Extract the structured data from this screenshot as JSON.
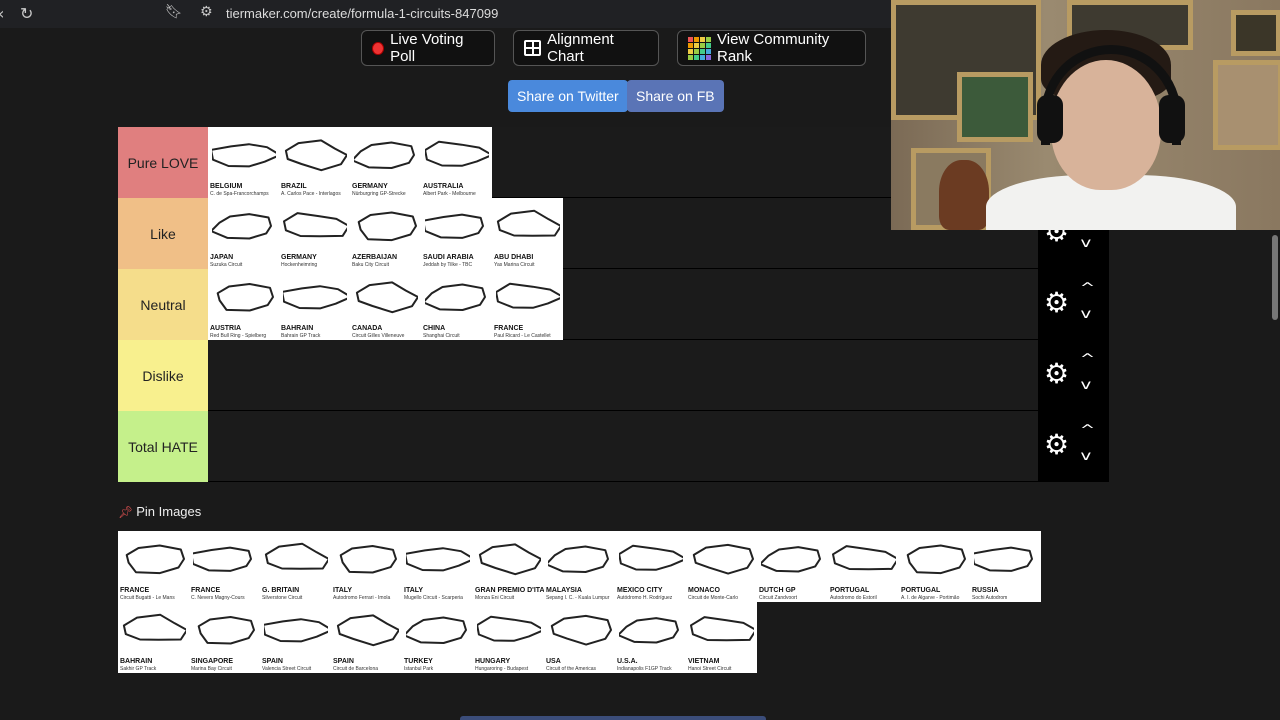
{
  "browser": {
    "url": "tiermaker.com/create/formula-1-circuits-847099",
    "reload_icon": "reload-icon",
    "bookmark_icon": "bookmark-icon",
    "site_settings_icon": "site-settings-icon"
  },
  "actions": {
    "live_voting": "Live Voting Poll",
    "alignment_chart": "Alignment Chart",
    "community_rank": "View Community Rank",
    "share_twitter": "Share on Twitter",
    "share_fb": "Share on FB"
  },
  "tiers": [
    {
      "label": "Pure LOVE",
      "color": "#e07f7f",
      "items": [
        {
          "name": "BELGIUM",
          "sub": "C. de Spa-Francorchamps"
        },
        {
          "name": "BRAZIL",
          "sub": "A. Carlos Pace - Interlagos"
        },
        {
          "name": "GERMANY",
          "sub": "Nürburgring GP-Strecke"
        },
        {
          "name": "AUSTRALIA",
          "sub": "Albert Park - Melbourne"
        }
      ]
    },
    {
      "label": "Like",
      "color": "#f0bf87",
      "items": [
        {
          "name": "JAPAN",
          "sub": "Suzuka Circuit"
        },
        {
          "name": "GERMANY",
          "sub": "Hockenheimring"
        },
        {
          "name": "AZERBAIJAN",
          "sub": "Baku City Circuit"
        },
        {
          "name": "SAUDI ARABIA",
          "sub": "Jeddah by Tilke - TBC"
        },
        {
          "name": "ABU DHABI",
          "sub": "Yas Marina Circuit"
        }
      ]
    },
    {
      "label": "Neutral",
      "color": "#f5dd8b",
      "items": [
        {
          "name": "AUSTRIA",
          "sub": "Red Bull Ring - Spielberg"
        },
        {
          "name": "BAHRAIN",
          "sub": "Bahrain GP Track"
        },
        {
          "name": "CANADA",
          "sub": "Circuit Gilles Villeneuve"
        },
        {
          "name": "CHINA",
          "sub": "Shanghai Circuit"
        },
        {
          "name": "FRANCE",
          "sub": "Paul Ricard - Le Castellet"
        }
      ]
    },
    {
      "label": "Dislike",
      "color": "#f8f08e",
      "items": []
    },
    {
      "label": "Total HATE",
      "color": "#c5f08b",
      "items": []
    }
  ],
  "tier_controls": {
    "gear_icon": "gear-icon",
    "up_icon": "chevron-up-icon",
    "down_icon": "chevron-down-icon"
  },
  "pin": {
    "label": "Pin Images",
    "icon": "pushpin-icon"
  },
  "pool": [
    {
      "name": "FRANCE",
      "sub": "Circuit Bugatti - Le Mans"
    },
    {
      "name": "FRANCE",
      "sub": "C. Nevers Magny-Cours"
    },
    {
      "name": "G. BRITAIN",
      "sub": "Silverstone Circuit"
    },
    {
      "name": "ITALY",
      "sub": "Autodromo Ferrari - Imola"
    },
    {
      "name": "ITALY",
      "sub": "Mugello Circuit - Scarperia"
    },
    {
      "name": "GRAN PREMIO D'ITALIA",
      "sub": "Monza Eni Circuit"
    },
    {
      "name": "MALAYSIA",
      "sub": "Sepang I. C. - Kuala Lumpur"
    },
    {
      "name": "MEXICO CITY",
      "sub": "Autódromo H. Rodríguez"
    },
    {
      "name": "MONACO",
      "sub": "Circuit de Monte-Carlo"
    },
    {
      "name": "DUTCH GP",
      "sub": "Circuit Zandvoort"
    },
    {
      "name": "PORTUGAL",
      "sub": "Autodromo do Estoril"
    },
    {
      "name": "PORTUGAL",
      "sub": "A. I. de Algarve - Portimão"
    },
    {
      "name": "RUSSIA",
      "sub": "Sochi Autodrom"
    },
    {
      "name": "BAHRAIN",
      "sub": "Sakhir GP Track"
    },
    {
      "name": "SINGAPORE",
      "sub": "Marina Bay Circuit"
    },
    {
      "name": "SPAIN",
      "sub": "Valencia Street Circuit"
    },
    {
      "name": "SPAIN",
      "sub": "Circuit de Barcelona"
    },
    {
      "name": "TURKEY",
      "sub": "Istanbul Park"
    },
    {
      "name": "HUNGARY",
      "sub": "Hungaroring - Budapest"
    },
    {
      "name": "USA",
      "sub": "Circuit of the Americas"
    },
    {
      "name": "U.S.A.",
      "sub": "Indianapolis F1GP Track"
    },
    {
      "name": "VIETNAM",
      "sub": "Hanoi Street Circuit"
    }
  ]
}
